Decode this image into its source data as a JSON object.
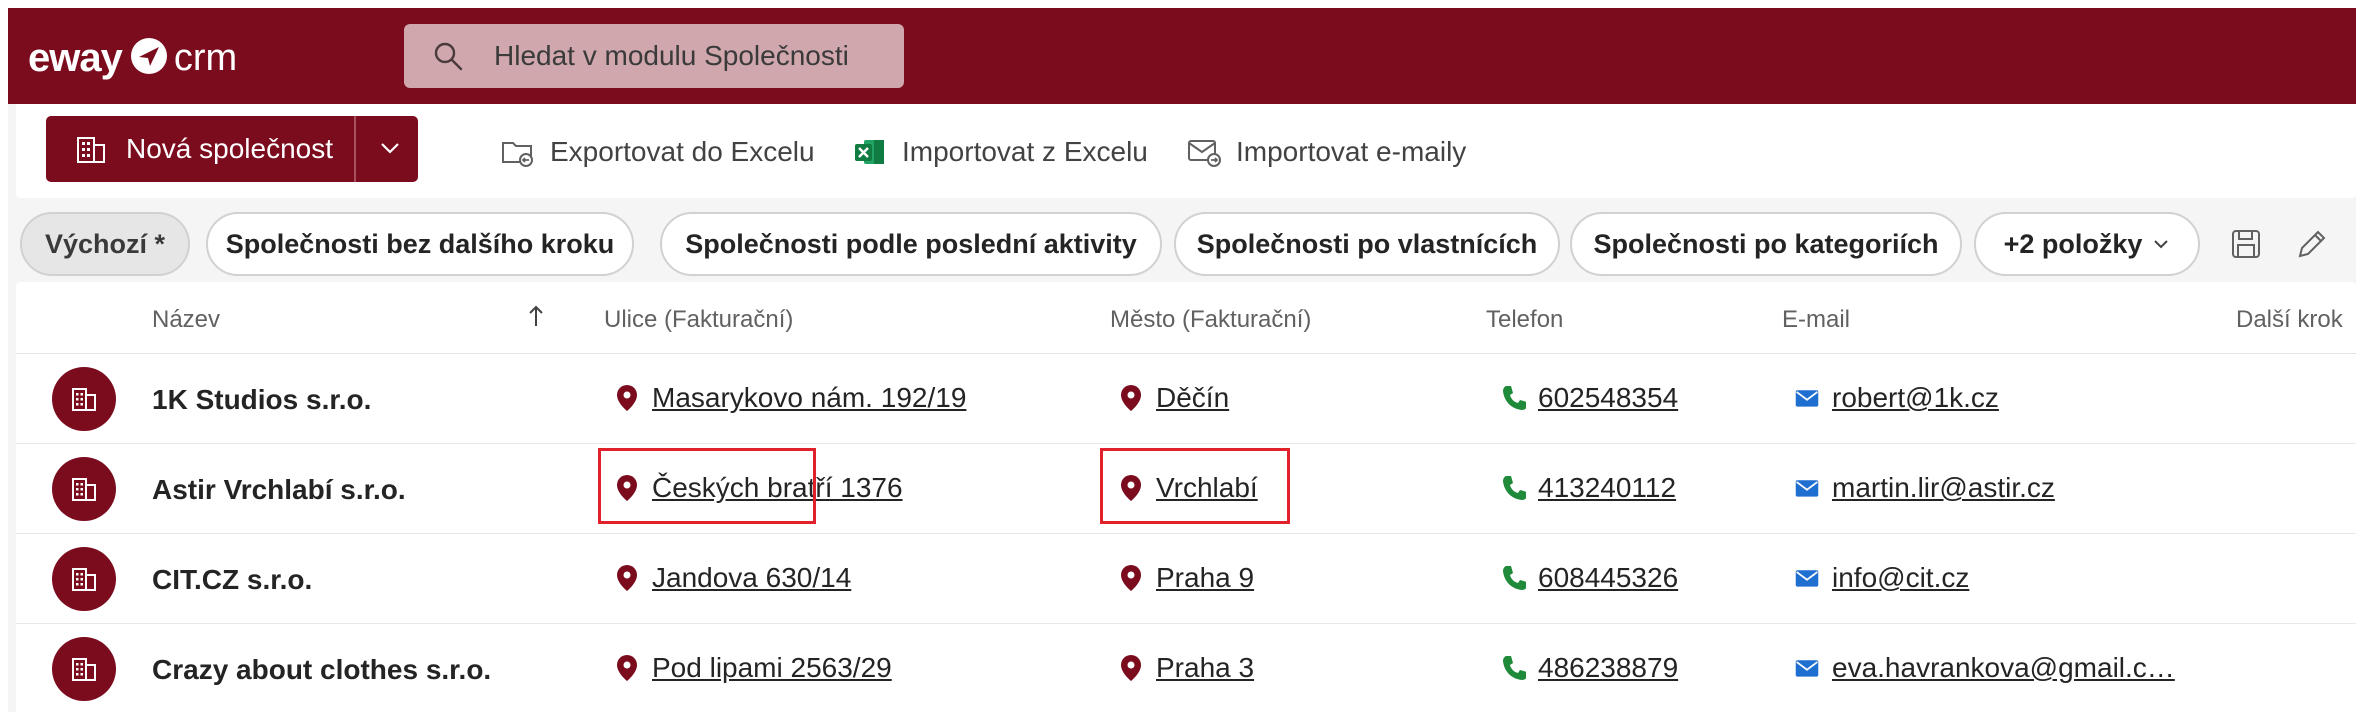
{
  "app": {
    "logo_part1": "eway",
    "logo_part2": "crm",
    "brand_color": "#7b0c1e",
    "search_placeholder": "Hledat v modulu Společnosti"
  },
  "toolbar": {
    "new_company_label": "Nová společnost",
    "export_label": "Exportovat do Excelu",
    "import_excel_label": "Importovat z Excelu",
    "import_emails_label": "Importovat e-maily"
  },
  "views": {
    "items": [
      "Výchozí *",
      "Společnosti bez dalšího kroku",
      "Společnosti podle poslední aktivity",
      "Společnosti po vlastnících",
      "Společnosti po kategoriích",
      "+2 položky"
    ],
    "active": "Výchozí *"
  },
  "grid": {
    "columns": [
      "Název",
      "Ulice (Fakturační)",
      "Město (Fakturační)",
      "Telefon",
      "E-mail",
      "Další krok"
    ],
    "sorted_column": "Název",
    "rows": [
      {
        "name": "1K Studios s.r.o.",
        "street": "Masarykovo nám. 192/19",
        "city": "Děčín",
        "phone": "602548354",
        "email": "robert@1k.cz"
      },
      {
        "name": "Astir Vrchlabí s.r.o.",
        "street": "Českých bratří 1376",
        "city": "Vrchlabí",
        "phone": "413240112",
        "email": "martin.lir@astir.cz"
      },
      {
        "name": "CIT.CZ s.r.o.",
        "street": "Jandova 630/14",
        "city": "Praha 9",
        "phone": "608445326",
        "email": "info@cit.cz"
      },
      {
        "name": "Crazy about clothes s.r.o.",
        "street": "Pod lipami 2563/29",
        "city": "Praha 3",
        "phone": "486238879",
        "email": "eva.havrankova@gmail.c…"
      }
    ]
  },
  "colors": {
    "location_icon": "#7b0c1e",
    "phone_icon": "#1f8a3a",
    "email_icon": "#1f6fd0",
    "highlight": "#e0202a"
  }
}
